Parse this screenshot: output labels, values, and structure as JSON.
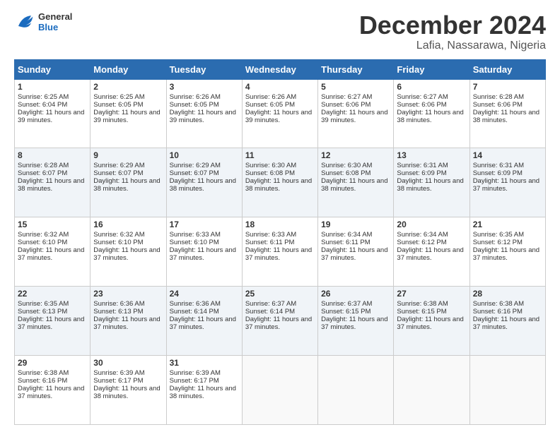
{
  "logo": {
    "line1": "General",
    "line2": "Blue"
  },
  "title": "December 2024",
  "subtitle": "Lafia, Nassarawa, Nigeria",
  "weekdays": [
    "Sunday",
    "Monday",
    "Tuesday",
    "Wednesday",
    "Thursday",
    "Friday",
    "Saturday"
  ],
  "weeks": [
    [
      {
        "day": 1,
        "rise": "6:25 AM",
        "set": "6:04 PM",
        "daylight": "11 hours and 39 minutes."
      },
      {
        "day": 2,
        "rise": "6:25 AM",
        "set": "6:05 PM",
        "daylight": "11 hours and 39 minutes."
      },
      {
        "day": 3,
        "rise": "6:26 AM",
        "set": "6:05 PM",
        "daylight": "11 hours and 39 minutes."
      },
      {
        "day": 4,
        "rise": "6:26 AM",
        "set": "6:05 PM",
        "daylight": "11 hours and 39 minutes."
      },
      {
        "day": 5,
        "rise": "6:27 AM",
        "set": "6:06 PM",
        "daylight": "11 hours and 39 minutes."
      },
      {
        "day": 6,
        "rise": "6:27 AM",
        "set": "6:06 PM",
        "daylight": "11 hours and 38 minutes."
      },
      {
        "day": 7,
        "rise": "6:28 AM",
        "set": "6:06 PM",
        "daylight": "11 hours and 38 minutes."
      }
    ],
    [
      {
        "day": 8,
        "rise": "6:28 AM",
        "set": "6:07 PM",
        "daylight": "11 hours and 38 minutes."
      },
      {
        "day": 9,
        "rise": "6:29 AM",
        "set": "6:07 PM",
        "daylight": "11 hours and 38 minutes."
      },
      {
        "day": 10,
        "rise": "6:29 AM",
        "set": "6:07 PM",
        "daylight": "11 hours and 38 minutes."
      },
      {
        "day": 11,
        "rise": "6:30 AM",
        "set": "6:08 PM",
        "daylight": "11 hours and 38 minutes."
      },
      {
        "day": 12,
        "rise": "6:30 AM",
        "set": "6:08 PM",
        "daylight": "11 hours and 38 minutes."
      },
      {
        "day": 13,
        "rise": "6:31 AM",
        "set": "6:09 PM",
        "daylight": "11 hours and 38 minutes."
      },
      {
        "day": 14,
        "rise": "6:31 AM",
        "set": "6:09 PM",
        "daylight": "11 hours and 37 minutes."
      }
    ],
    [
      {
        "day": 15,
        "rise": "6:32 AM",
        "set": "6:10 PM",
        "daylight": "11 hours and 37 minutes."
      },
      {
        "day": 16,
        "rise": "6:32 AM",
        "set": "6:10 PM",
        "daylight": "11 hours and 37 minutes."
      },
      {
        "day": 17,
        "rise": "6:33 AM",
        "set": "6:10 PM",
        "daylight": "11 hours and 37 minutes."
      },
      {
        "day": 18,
        "rise": "6:33 AM",
        "set": "6:11 PM",
        "daylight": "11 hours and 37 minutes."
      },
      {
        "day": 19,
        "rise": "6:34 AM",
        "set": "6:11 PM",
        "daylight": "11 hours and 37 minutes."
      },
      {
        "day": 20,
        "rise": "6:34 AM",
        "set": "6:12 PM",
        "daylight": "11 hours and 37 minutes."
      },
      {
        "day": 21,
        "rise": "6:35 AM",
        "set": "6:12 PM",
        "daylight": "11 hours and 37 minutes."
      }
    ],
    [
      {
        "day": 22,
        "rise": "6:35 AM",
        "set": "6:13 PM",
        "daylight": "11 hours and 37 minutes."
      },
      {
        "day": 23,
        "rise": "6:36 AM",
        "set": "6:13 PM",
        "daylight": "11 hours and 37 minutes."
      },
      {
        "day": 24,
        "rise": "6:36 AM",
        "set": "6:14 PM",
        "daylight": "11 hours and 37 minutes."
      },
      {
        "day": 25,
        "rise": "6:37 AM",
        "set": "6:14 PM",
        "daylight": "11 hours and 37 minutes."
      },
      {
        "day": 26,
        "rise": "6:37 AM",
        "set": "6:15 PM",
        "daylight": "11 hours and 37 minutes."
      },
      {
        "day": 27,
        "rise": "6:38 AM",
        "set": "6:15 PM",
        "daylight": "11 hours and 37 minutes."
      },
      {
        "day": 28,
        "rise": "6:38 AM",
        "set": "6:16 PM",
        "daylight": "11 hours and 37 minutes."
      }
    ],
    [
      {
        "day": 29,
        "rise": "6:38 AM",
        "set": "6:16 PM",
        "daylight": "11 hours and 37 minutes."
      },
      {
        "day": 30,
        "rise": "6:39 AM",
        "set": "6:17 PM",
        "daylight": "11 hours and 38 minutes."
      },
      {
        "day": 31,
        "rise": "6:39 AM",
        "set": "6:17 PM",
        "daylight": "11 hours and 38 minutes."
      },
      null,
      null,
      null,
      null
    ]
  ]
}
